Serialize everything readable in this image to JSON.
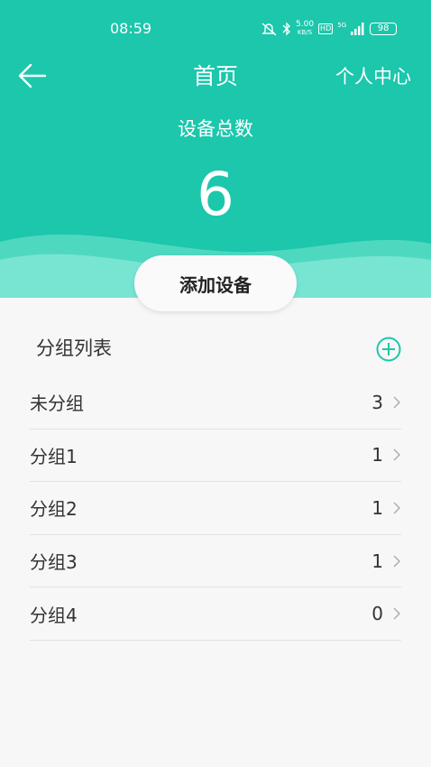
{
  "status_bar": {
    "time": "08:59",
    "net_speed_value": "5.00",
    "net_speed_unit": "KB/S",
    "hd_label": "HD",
    "network_label": "5G",
    "battery": "98"
  },
  "nav": {
    "title": "首页",
    "profile_label": "个人中心",
    "back_icon": "arrow-left-icon"
  },
  "summary": {
    "label": "设备总数",
    "count": "6"
  },
  "add_device_label": "添加设备",
  "groups": {
    "title": "分组列表",
    "add_icon": "plus-circle-icon",
    "items": [
      {
        "name": "未分组",
        "count": "3"
      },
      {
        "name": "分组1",
        "count": "1"
      },
      {
        "name": "分组2",
        "count": "1"
      },
      {
        "name": "分组3",
        "count": "1"
      },
      {
        "name": "分组4",
        "count": "0"
      }
    ]
  },
  "colors": {
    "primary": "#1cc7ac",
    "wave_light": "#78e5d3",
    "background": "#f7f7f7",
    "text": "#333333"
  }
}
